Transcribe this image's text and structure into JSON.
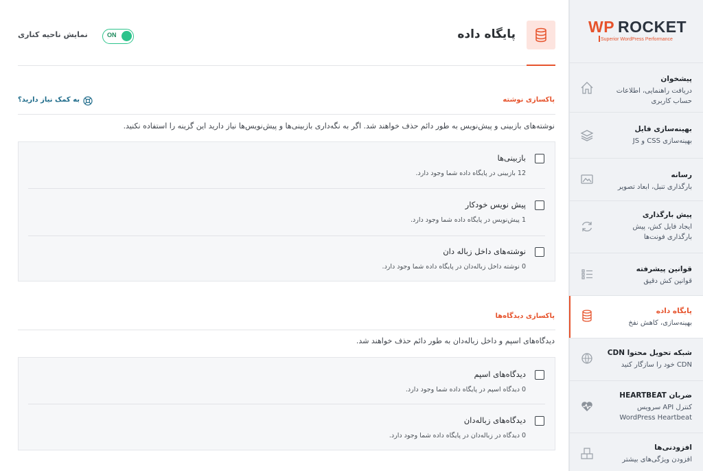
{
  "brand": {
    "wp": "WP",
    "rocket": "ROCKET",
    "tagline": "Superior WordPress Performance"
  },
  "sidebar": {
    "items": [
      {
        "title": "پیشخوان",
        "desc": "دریافت راهنمایی، اطلاعات حساب کاربری",
        "icon": "home-icon"
      },
      {
        "title": "بهینه‌سازی فایل",
        "desc": "بهینه‌سازی CSS و JS",
        "icon": "layers-icon"
      },
      {
        "title": "رسانه",
        "desc": "بارگذاری تنبل، ابعاد تصویر",
        "icon": "image-icon"
      },
      {
        "title": "پیش بارگذاری",
        "desc": "ایجاد فایل کش، پیش بارگذاری فونت‌ها",
        "icon": "refresh-icon"
      },
      {
        "title": "قوانین پیشرفته",
        "desc": "قوانین کش دقیق",
        "icon": "list-icon"
      },
      {
        "title": "پایگاه داده",
        "desc": "بهینه‌سازی، کاهش نفخ",
        "icon": "database-icon",
        "active": true
      },
      {
        "title": "شبکه تحویل محتوا CDN",
        "desc": "CDN خود را سازگار کنید",
        "icon": "cdn-icon"
      },
      {
        "title": "ضربان HEARTBEAT",
        "desc": "کنترل API سرویس WordPress Heartbeat",
        "icon": "heartbeat-icon"
      },
      {
        "title": "افزودنی‌ها",
        "desc": "افزودن ویژگی‌های بیشتر",
        "icon": "addons-icon"
      }
    ]
  },
  "header": {
    "title": "پایگاه داده",
    "toggle_label": "نمایش ناحیه کناری",
    "toggle_state": "ON"
  },
  "help": {
    "label": "به کمک نیاز دارید؟"
  },
  "posts": {
    "title": "پاکسازی نوشته",
    "desc": "نوشته‌های بازبینی و پیش‌نویس به طور دائم حذف خواهند شد. اگر به نگه‌داری بازبینی‌ها و پیش‌نویس‌ها نیاز دارید این گزینه را استفاده نکنید.",
    "options": [
      {
        "label": "بازبینی‌ها",
        "sub": "12 بازبینی در پایگاه داده شما وجود دارد."
      },
      {
        "label": "پیش نویس خودکار",
        "sub": "1 پیش‌نویس در پایگاه داده شما وجود دارد."
      },
      {
        "label": "نوشته‌های داخل زباله دان",
        "sub": "0 نوشته داخل زباله‌دان در پایگاه داده شما وجود دارد."
      }
    ]
  },
  "comments": {
    "title": "پاکسازی دیدگاه‌ها",
    "desc": "دیدگاه‌های اسپم و داخل زباله‌دان به طور دائم حذف خواهند شد.",
    "options": [
      {
        "label": "دیدگاه‌های اسپم",
        "sub": "0 دیدگاه اسپم در پایگاه داده شما وجود دارد."
      },
      {
        "label": "دیدگاه‌های زباله‌دان",
        "sub": "0 دیدگاه در زباله‌دان در پایگاه داده شما وجود دارد."
      }
    ]
  },
  "colors": {
    "accent": "#e6532c",
    "toggle": "#2cc38b",
    "link": "#1e6b8a"
  }
}
